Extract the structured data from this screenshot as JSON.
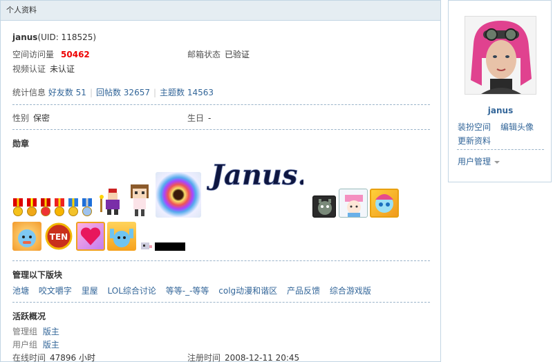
{
  "panel": {
    "title": "个人资料"
  },
  "user": {
    "name": "janus",
    "uid": "(UID: 118525)"
  },
  "stats": {
    "visits_label": "空间访问量",
    "visits_value": "50462",
    "email_label": "邮箱状态",
    "email_value": "已验证",
    "video_label": "视频认证",
    "video_value": "未认证",
    "summary_label": "统计信息",
    "friends": "好友数 51",
    "replies": "回帖数 32657",
    "threads": "主题数 14563"
  },
  "profile": {
    "gender_label": "性别",
    "gender_value": "保密",
    "birthday_label": "生日",
    "birthday_value": "-"
  },
  "medals": {
    "title": "勋章",
    "signature": "Janus."
  },
  "manage": {
    "title": "管理以下版块",
    "boards": [
      "池塘",
      "咬文嚼字",
      "里屋",
      "LOL综合讨论",
      "等等-_-等等",
      "colg动漫和谐区",
      "产品反馈",
      "综合游戏版"
    ]
  },
  "activity": {
    "title": "活跃概况",
    "admin_group_label": "管理组",
    "admin_group_value": "版主",
    "user_group_label": "用户组",
    "user_group_value": "版主",
    "online_label": "在线时间",
    "online_value": "47896 小时",
    "register_label": "注册时间",
    "register_value": "2008-12-11 20:45"
  },
  "sidebar": {
    "name": "janus",
    "dress_space": "装扮空间",
    "edit_avatar": "编辑头像",
    "update_profile": "更新资料",
    "user_manage": "用户管理"
  },
  "colors": {
    "link": "#336699",
    "hot": "#ee0000",
    "border": "#c2d5e3",
    "header_bg": "#e5edf2"
  }
}
